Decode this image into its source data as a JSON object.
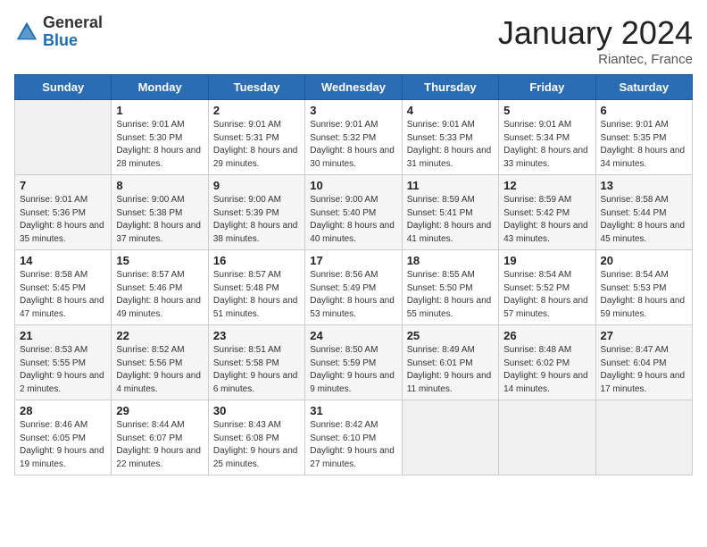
{
  "header": {
    "logo_general": "General",
    "logo_blue": "Blue",
    "title": "January 2024",
    "subtitle": "Riantec, France"
  },
  "weekdays": [
    "Sunday",
    "Monday",
    "Tuesday",
    "Wednesday",
    "Thursday",
    "Friday",
    "Saturday"
  ],
  "weeks": [
    [
      {
        "day": "",
        "sunrise": "",
        "sunset": "",
        "daylight": ""
      },
      {
        "day": "1",
        "sunrise": "Sunrise: 9:01 AM",
        "sunset": "Sunset: 5:30 PM",
        "daylight": "Daylight: 8 hours and 28 minutes."
      },
      {
        "day": "2",
        "sunrise": "Sunrise: 9:01 AM",
        "sunset": "Sunset: 5:31 PM",
        "daylight": "Daylight: 8 hours and 29 minutes."
      },
      {
        "day": "3",
        "sunrise": "Sunrise: 9:01 AM",
        "sunset": "Sunset: 5:32 PM",
        "daylight": "Daylight: 8 hours and 30 minutes."
      },
      {
        "day": "4",
        "sunrise": "Sunrise: 9:01 AM",
        "sunset": "Sunset: 5:33 PM",
        "daylight": "Daylight: 8 hours and 31 minutes."
      },
      {
        "day": "5",
        "sunrise": "Sunrise: 9:01 AM",
        "sunset": "Sunset: 5:34 PM",
        "daylight": "Daylight: 8 hours and 33 minutes."
      },
      {
        "day": "6",
        "sunrise": "Sunrise: 9:01 AM",
        "sunset": "Sunset: 5:35 PM",
        "daylight": "Daylight: 8 hours and 34 minutes."
      }
    ],
    [
      {
        "day": "7",
        "sunrise": "Sunrise: 9:01 AM",
        "sunset": "Sunset: 5:36 PM",
        "daylight": "Daylight: 8 hours and 35 minutes."
      },
      {
        "day": "8",
        "sunrise": "Sunrise: 9:00 AM",
        "sunset": "Sunset: 5:38 PM",
        "daylight": "Daylight: 8 hours and 37 minutes."
      },
      {
        "day": "9",
        "sunrise": "Sunrise: 9:00 AM",
        "sunset": "Sunset: 5:39 PM",
        "daylight": "Daylight: 8 hours and 38 minutes."
      },
      {
        "day": "10",
        "sunrise": "Sunrise: 9:00 AM",
        "sunset": "Sunset: 5:40 PM",
        "daylight": "Daylight: 8 hours and 40 minutes."
      },
      {
        "day": "11",
        "sunrise": "Sunrise: 8:59 AM",
        "sunset": "Sunset: 5:41 PM",
        "daylight": "Daylight: 8 hours and 41 minutes."
      },
      {
        "day": "12",
        "sunrise": "Sunrise: 8:59 AM",
        "sunset": "Sunset: 5:42 PM",
        "daylight": "Daylight: 8 hours and 43 minutes."
      },
      {
        "day": "13",
        "sunrise": "Sunrise: 8:58 AM",
        "sunset": "Sunset: 5:44 PM",
        "daylight": "Daylight: 8 hours and 45 minutes."
      }
    ],
    [
      {
        "day": "14",
        "sunrise": "Sunrise: 8:58 AM",
        "sunset": "Sunset: 5:45 PM",
        "daylight": "Daylight: 8 hours and 47 minutes."
      },
      {
        "day": "15",
        "sunrise": "Sunrise: 8:57 AM",
        "sunset": "Sunset: 5:46 PM",
        "daylight": "Daylight: 8 hours and 49 minutes."
      },
      {
        "day": "16",
        "sunrise": "Sunrise: 8:57 AM",
        "sunset": "Sunset: 5:48 PM",
        "daylight": "Daylight: 8 hours and 51 minutes."
      },
      {
        "day": "17",
        "sunrise": "Sunrise: 8:56 AM",
        "sunset": "Sunset: 5:49 PM",
        "daylight": "Daylight: 8 hours and 53 minutes."
      },
      {
        "day": "18",
        "sunrise": "Sunrise: 8:55 AM",
        "sunset": "Sunset: 5:50 PM",
        "daylight": "Daylight: 8 hours and 55 minutes."
      },
      {
        "day": "19",
        "sunrise": "Sunrise: 8:54 AM",
        "sunset": "Sunset: 5:52 PM",
        "daylight": "Daylight: 8 hours and 57 minutes."
      },
      {
        "day": "20",
        "sunrise": "Sunrise: 8:54 AM",
        "sunset": "Sunset: 5:53 PM",
        "daylight": "Daylight: 8 hours and 59 minutes."
      }
    ],
    [
      {
        "day": "21",
        "sunrise": "Sunrise: 8:53 AM",
        "sunset": "Sunset: 5:55 PM",
        "daylight": "Daylight: 9 hours and 2 minutes."
      },
      {
        "day": "22",
        "sunrise": "Sunrise: 8:52 AM",
        "sunset": "Sunset: 5:56 PM",
        "daylight": "Daylight: 9 hours and 4 minutes."
      },
      {
        "day": "23",
        "sunrise": "Sunrise: 8:51 AM",
        "sunset": "Sunset: 5:58 PM",
        "daylight": "Daylight: 9 hours and 6 minutes."
      },
      {
        "day": "24",
        "sunrise": "Sunrise: 8:50 AM",
        "sunset": "Sunset: 5:59 PM",
        "daylight": "Daylight: 9 hours and 9 minutes."
      },
      {
        "day": "25",
        "sunrise": "Sunrise: 8:49 AM",
        "sunset": "Sunset: 6:01 PM",
        "daylight": "Daylight: 9 hours and 11 minutes."
      },
      {
        "day": "26",
        "sunrise": "Sunrise: 8:48 AM",
        "sunset": "Sunset: 6:02 PM",
        "daylight": "Daylight: 9 hours and 14 minutes."
      },
      {
        "day": "27",
        "sunrise": "Sunrise: 8:47 AM",
        "sunset": "Sunset: 6:04 PM",
        "daylight": "Daylight: 9 hours and 17 minutes."
      }
    ],
    [
      {
        "day": "28",
        "sunrise": "Sunrise: 8:46 AM",
        "sunset": "Sunset: 6:05 PM",
        "daylight": "Daylight: 9 hours and 19 minutes."
      },
      {
        "day": "29",
        "sunrise": "Sunrise: 8:44 AM",
        "sunset": "Sunset: 6:07 PM",
        "daylight": "Daylight: 9 hours and 22 minutes."
      },
      {
        "day": "30",
        "sunrise": "Sunrise: 8:43 AM",
        "sunset": "Sunset: 6:08 PM",
        "daylight": "Daylight: 9 hours and 25 minutes."
      },
      {
        "day": "31",
        "sunrise": "Sunrise: 8:42 AM",
        "sunset": "Sunset: 6:10 PM",
        "daylight": "Daylight: 9 hours and 27 minutes."
      },
      {
        "day": "",
        "sunrise": "",
        "sunset": "",
        "daylight": ""
      },
      {
        "day": "",
        "sunrise": "",
        "sunset": "",
        "daylight": ""
      },
      {
        "day": "",
        "sunrise": "",
        "sunset": "",
        "daylight": ""
      }
    ]
  ]
}
